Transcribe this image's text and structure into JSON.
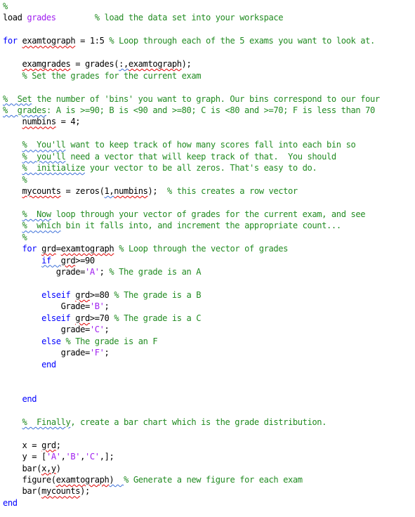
{
  "colors": {
    "keyword": "#0000ff",
    "string": "#a020f0",
    "comment": "#228b22",
    "text": "#000000",
    "spell_error": "#e00000",
    "spell_warning": "#3b6fd8"
  },
  "editor": {
    "lines": [
      [
        {
          "t": "%",
          "c": "cm"
        }
      ],
      [
        {
          "t": "load ",
          "c": ""
        },
        {
          "t": "grades",
          "c": "str"
        },
        {
          "t": "        ",
          "c": ""
        },
        {
          "t": "% load the data set into your workspace",
          "c": "cm"
        }
      ],
      [],
      [
        {
          "t": "for",
          "c": "kw"
        },
        {
          "t": " ",
          "c": ""
        },
        {
          "t": "examtograph",
          "c": "sq"
        },
        {
          "t": " = 1:5 ",
          "c": ""
        },
        {
          "t": "% Loop through each of the 5 exams you want to look at.",
          "c": "cm"
        }
      ],
      [],
      [
        {
          "t": "    ",
          "c": ""
        },
        {
          "t": "examgrades",
          "c": "sq"
        },
        {
          "t": " = grades(",
          "c": ""
        },
        {
          "t": ":,",
          "c": "sqb"
        },
        {
          "t": "examtograph",
          "c": "sq"
        },
        {
          "t": ");",
          "c": ""
        }
      ],
      [
        {
          "t": "    ",
          "c": ""
        },
        {
          "t": "% Set the grades for the current exam",
          "c": "cm"
        }
      ],
      [],
      [
        {
          "t": "%  Set",
          "c": "cm sqb"
        },
        {
          "t": " the number of 'bins' you want to graph. Our bins correspond to our four",
          "c": "cm"
        }
      ],
      [
        {
          "t": "%  grades",
          "c": "cm sqb"
        },
        {
          "t": ": A is >=90; B is <90 and >=80; C is <80 and >=70; F is less than 70",
          "c": "cm"
        }
      ],
      [
        {
          "t": "    ",
          "c": ""
        },
        {
          "t": "numbins",
          "c": "sq"
        },
        {
          "t": " = 4;",
          "c": ""
        }
      ],
      [],
      [
        {
          "t": "    ",
          "c": ""
        },
        {
          "t": "%  You'll",
          "c": "cm sqb"
        },
        {
          "t": " want to keep track of how many scores fall into each bin so",
          "c": "cm"
        }
      ],
      [
        {
          "t": "    ",
          "c": ""
        },
        {
          "t": "%  you'll",
          "c": "cm sqb"
        },
        {
          "t": " need a vector that will keep track of that.  You should",
          "c": "cm"
        }
      ],
      [
        {
          "t": "    ",
          "c": ""
        },
        {
          "t": "%  initialize",
          "c": "cm sqb"
        },
        {
          "t": " your vector to be all zeros. That's easy to do.",
          "c": "cm"
        }
      ],
      [
        {
          "t": "    ",
          "c": ""
        },
        {
          "t": "%",
          "c": "cm"
        }
      ],
      [
        {
          "t": "    ",
          "c": ""
        },
        {
          "t": "mycounts",
          "c": "sq"
        },
        {
          "t": " = zeros(",
          "c": ""
        },
        {
          "t": "1,",
          "c": "sqb"
        },
        {
          "t": "numbins",
          "c": "sq"
        },
        {
          "t": ");  ",
          "c": ""
        },
        {
          "t": "% this creates a row vector",
          "c": "cm"
        }
      ],
      [],
      [
        {
          "t": "    ",
          "c": ""
        },
        {
          "t": "%  Now",
          "c": "cm sqb"
        },
        {
          "t": " loop through your vector of grades for the current exam, and see",
          "c": "cm"
        }
      ],
      [
        {
          "t": "    ",
          "c": ""
        },
        {
          "t": "%  which",
          "c": "cm sqb"
        },
        {
          "t": " bin it falls into, and increment the appropriate count...",
          "c": "cm"
        }
      ],
      [
        {
          "t": "    ",
          "c": ""
        },
        {
          "t": "%",
          "c": "cm"
        }
      ],
      [
        {
          "t": "    ",
          "c": ""
        },
        {
          "t": "for",
          "c": "kw"
        },
        {
          "t": " ",
          "c": ""
        },
        {
          "t": "grd",
          "c": "sq"
        },
        {
          "t": "=",
          "c": ""
        },
        {
          "t": "examtograph",
          "c": "sq"
        },
        {
          "t": " ",
          "c": ""
        },
        {
          "t": "% Loop through the vector of grades",
          "c": "cm"
        }
      ],
      [
        {
          "t": "        ",
          "c": ""
        },
        {
          "t": "if",
          "c": "kw sqb"
        },
        {
          "t": "  ",
          "c": "sqb"
        },
        {
          "t": "grd",
          "c": "sq"
        },
        {
          "t": ">=90",
          "c": ""
        }
      ],
      [
        {
          "t": "           grade=",
          "c": ""
        },
        {
          "t": "'A'",
          "c": "str"
        },
        {
          "t": "; ",
          "c": ""
        },
        {
          "t": "% The grade is an A",
          "c": "cm"
        }
      ],
      [],
      [
        {
          "t": "        ",
          "c": ""
        },
        {
          "t": "elseif",
          "c": "kw"
        },
        {
          "t": " ",
          "c": ""
        },
        {
          "t": "grd",
          "c": "sq"
        },
        {
          "t": ">=80 ",
          "c": ""
        },
        {
          "t": "% The grade is a B",
          "c": "cm"
        }
      ],
      [
        {
          "t": "            Grade=",
          "c": ""
        },
        {
          "t": "'B'",
          "c": "str"
        },
        {
          "t": ";",
          "c": ""
        }
      ],
      [
        {
          "t": "        ",
          "c": ""
        },
        {
          "t": "elseif",
          "c": "kw"
        },
        {
          "t": " ",
          "c": ""
        },
        {
          "t": "grd",
          "c": "sq"
        },
        {
          "t": ">=70 ",
          "c": ""
        },
        {
          "t": "% The grade is a C",
          "c": "cm"
        }
      ],
      [
        {
          "t": "            grade=",
          "c": ""
        },
        {
          "t": "'C'",
          "c": "str"
        },
        {
          "t": ";",
          "c": ""
        }
      ],
      [
        {
          "t": "        ",
          "c": ""
        },
        {
          "t": "else",
          "c": "kw"
        },
        {
          "t": " ",
          "c": ""
        },
        {
          "t": "% The grade is an F",
          "c": "cm"
        }
      ],
      [
        {
          "t": "            grade=",
          "c": ""
        },
        {
          "t": "'F'",
          "c": "str"
        },
        {
          "t": ";",
          "c": ""
        }
      ],
      [
        {
          "t": "        ",
          "c": ""
        },
        {
          "t": "end",
          "c": "kw"
        }
      ],
      [],
      [],
      [
        {
          "t": "    ",
          "c": ""
        },
        {
          "t": "end",
          "c": "kw"
        }
      ],
      [],
      [
        {
          "t": "    ",
          "c": ""
        },
        {
          "t": "%  Finally",
          "c": "cm sqb"
        },
        {
          "t": ", create a bar chart which is the grade distribution.",
          "c": "cm"
        }
      ],
      [],
      [
        {
          "t": "    x = ",
          "c": ""
        },
        {
          "t": "grd",
          "c": "sq"
        },
        {
          "t": ";",
          "c": ""
        }
      ],
      [
        {
          "t": "    y = [",
          "c": ""
        },
        {
          "t": "'A'",
          "c": "str"
        },
        {
          "t": ",",
          "c": ""
        },
        {
          "t": "'B'",
          "c": "str"
        },
        {
          "t": ",",
          "c": ""
        },
        {
          "t": "'C'",
          "c": "str"
        },
        {
          "t": ",];",
          "c": ""
        }
      ],
      [
        {
          "t": "    bar(",
          "c": ""
        },
        {
          "t": "x,y",
          "c": "sq"
        },
        {
          "t": ")",
          "c": ""
        }
      ],
      [
        {
          "t": "    figure(",
          "c": ""
        },
        {
          "t": "examtograph",
          "c": "sq"
        },
        {
          "t": ")  ",
          "c": "sqb"
        },
        {
          "t": "% Generate a new figure for each exam",
          "c": "cm"
        }
      ],
      [
        {
          "t": "    bar(",
          "c": ""
        },
        {
          "t": "mycounts",
          "c": "sq"
        },
        {
          "t": ");",
          "c": ""
        }
      ],
      [
        {
          "t": "end",
          "c": "kw"
        }
      ]
    ]
  }
}
